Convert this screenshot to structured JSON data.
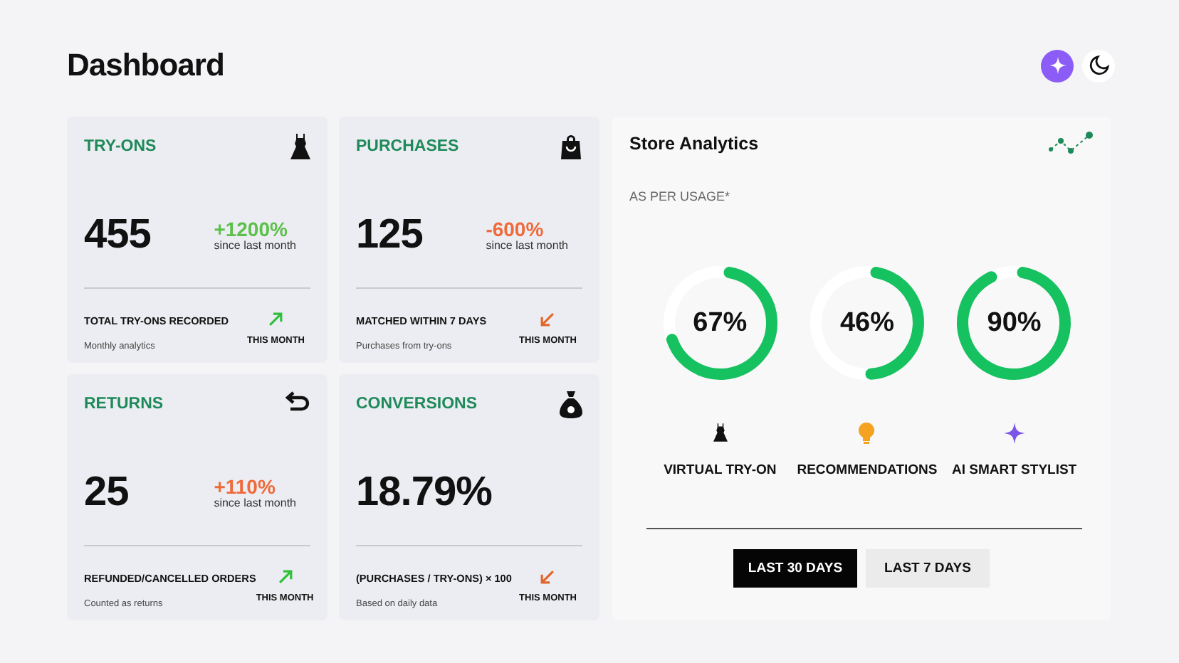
{
  "title": "Dashboard",
  "cards": [
    {
      "label": "TRY-ONS",
      "value": "455",
      "change": "+1200%",
      "change_positive": true,
      "change_note": "since last month",
      "footer_title": "TOTAL TRY-ONS RECORDED",
      "footer_note": "Monthly analytics",
      "trend_up": true,
      "period": "THIS MONTH"
    },
    {
      "label": "PURCHASES",
      "value": "125",
      "change": "-600%",
      "change_positive": false,
      "change_note": "since last month",
      "footer_title": "MATCHED WITHIN 7 DAYS",
      "footer_note": "Purchases from try-ons",
      "trend_up": false,
      "period": "THIS MONTH"
    },
    {
      "label": "RETURNS",
      "value": "25",
      "change": "+110%",
      "change_positive": false,
      "change_note": "since last month",
      "footer_title": "REFUNDED/CANCELLED ORDERS",
      "footer_note": "Counted as returns",
      "trend_up": true,
      "period": "THIS MONTH"
    },
    {
      "label": "CONVERSIONS",
      "value": "18.79%",
      "footer_title": "(PURCHASES / TRY-ONS) × 100",
      "footer_note": "Based on daily data",
      "trend_up": false,
      "period": "THIS MONTH"
    }
  ],
  "analytics": {
    "title": "Store Analytics",
    "subtitle": "AS PER USAGE*",
    "gauges": [
      {
        "reading": "67%",
        "label": "VIRTUAL TRY-ON"
      },
      {
        "reading": "46%",
        "label": "RECOMMENDATIONS"
      },
      {
        "reading": "90%",
        "label": "AI SMART STYLIST"
      }
    ],
    "ranges": [
      {
        "label": "LAST 30 DAYS",
        "selected": true
      },
      {
        "label": "LAST 7 DAYS",
        "selected": false
      }
    ]
  }
}
